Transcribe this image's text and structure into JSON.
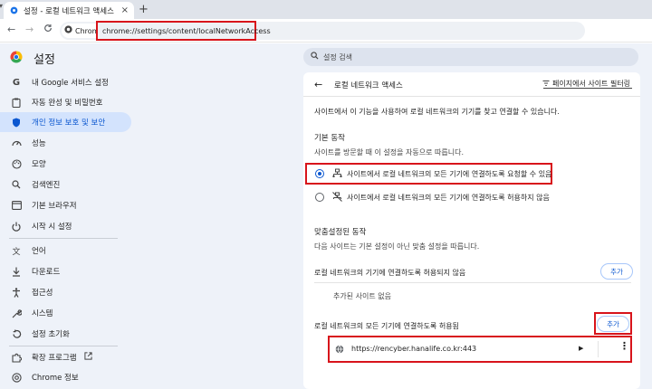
{
  "tab": {
    "title": "설정 - 로컬 네트워크 액세스",
    "close": "×",
    "new_tab": "+"
  },
  "toolbar": {
    "back": "←",
    "forward": "→",
    "reload": "C",
    "chip_label": "Chrome",
    "url": "chrome://settings/content/localNetworkAccess"
  },
  "header": {
    "title": "설정",
    "search_placeholder": "설정 검색"
  },
  "sidebar": {
    "items": [
      {
        "label": "내 Google 서비스 설정",
        "icon": "google-icon"
      },
      {
        "label": "자동 완성 및 비밀번호",
        "icon": "clipboard-icon"
      },
      {
        "label": "개인 정보 보호 및 보안",
        "icon": "shield-icon"
      },
      {
        "label": "성능",
        "icon": "speedometer-icon"
      },
      {
        "label": "모양",
        "icon": "palette-icon"
      },
      {
        "label": "검색엔진",
        "icon": "search-icon"
      },
      {
        "label": "기본 브라우저",
        "icon": "browser-icon"
      },
      {
        "label": "시작 시 설정",
        "icon": "power-icon"
      },
      {
        "label": "언어",
        "icon": "translate-icon"
      },
      {
        "label": "다운로드",
        "icon": "download-icon"
      },
      {
        "label": "접근성",
        "icon": "accessibility-icon"
      },
      {
        "label": "시스템",
        "icon": "wrench-icon"
      },
      {
        "label": "설정 초기화",
        "icon": "reset-icon"
      },
      {
        "label": "확장 프로그램",
        "icon": "puzzle-icon"
      },
      {
        "label": "Chrome 정보",
        "icon": "chrome-icon"
      }
    ]
  },
  "page": {
    "title": "로컬 네트워크 액세스",
    "filter_label": "페이지에서 사이트 필터링",
    "description": "사이트에서 이 기능을 사용하여 로컬 네트워크의 기기를 찾고 연결할 수 있습니다.",
    "default_heading": "기본 동작",
    "default_sub": "사이트를 방문할 때 이 설정을 자동으로 따릅니다.",
    "option_ask": "사이트에서 로컬 네트워크의 모든 기기에 연결하도록 요청할 수 있음",
    "option_block": "사이트에서 로컬 네트워크의 모든 기기에 연결하도록 허용하지 않음",
    "custom_heading": "맞춤설정된 동작",
    "custom_sub": "다음 사이트는 기본 설정이 아닌 맞춤 설정을 따릅니다.",
    "blocked_heading": "로컬 네트워크의 기기에 연결하도록 허용되지 않음",
    "add_label": "추가",
    "no_sites": "추가된 사이트 없음",
    "allowed_heading": "로컬 네트워크의 모든 기기에 연결하도록 허용됨",
    "allowed_site": "https://rencyber.hanalife.co.kr:443"
  },
  "colors": {
    "accent": "#0b57d0",
    "highlight": "#d8141b",
    "sidebar_bg": "#eef2f9",
    "active_bg": "#d3e3fd"
  }
}
